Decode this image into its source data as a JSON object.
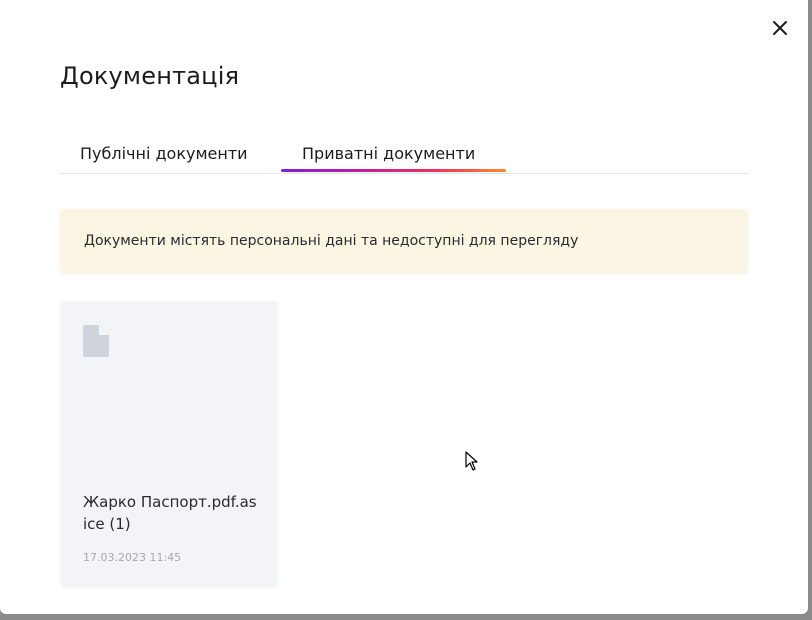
{
  "dialog": {
    "title": "Документація",
    "close_icon": "close-icon"
  },
  "tabs": [
    {
      "label": "Публічні документи",
      "active": false
    },
    {
      "label": "Приватні документи",
      "active": true
    }
  ],
  "tab_accent_gradient": [
    "#7b1fe0",
    "#c41aa0",
    "#f0325a",
    "#ff8a2a"
  ],
  "notice": {
    "text": "Документи містять персональні дані та недоступні для перегляду",
    "background": "#fbf6e4"
  },
  "documents": [
    {
      "icon": "file-icon",
      "name": "Жарко Паспорт.pdf.asice (1)",
      "date": "17.03.2023 11:45"
    }
  ]
}
